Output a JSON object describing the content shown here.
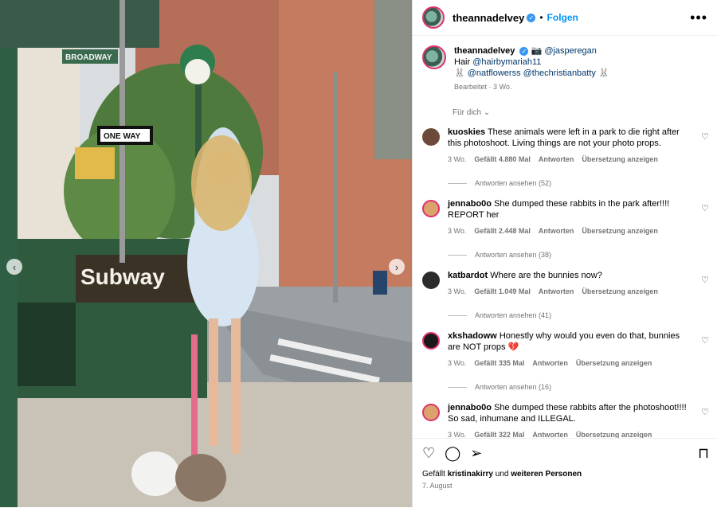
{
  "post": {
    "username": "theannadelvey",
    "follow_label": "Folgen",
    "more_label": "•••",
    "caption": {
      "line1_handle": "@jasperegan",
      "line2_prefix": "Hair ",
      "line2_handle": "@hairbymariah11",
      "line3_handle1": "@natflowerss",
      "line3_handle2": "@thechristianbatty",
      "meta": "Bearbeitet · 3 Wo."
    },
    "sort_label": "Für dich",
    "likes_prefix": "Gefällt ",
    "likes_user": "kristinakirry",
    "likes_mid": " und ",
    "likes_others": "weiteren Personen",
    "date": "7. August"
  },
  "street_signs": {
    "broadway": "BROADWAY",
    "one_way": "ONE WAY",
    "subway": "Subway"
  },
  "comments": [
    {
      "user": "kuoskies",
      "text": "These animals were left in a park to die right after this photoshoot. Living things are not your photo props.",
      "age": "3 Wo.",
      "likes": "Gefällt 4.880 Mal",
      "reply": "Antworten",
      "translate": "Übersetzung anzeigen",
      "view_replies": "Antworten ansehen (52)"
    },
    {
      "user": "jennabo0o",
      "text": "She dumped these rabbits in the park after!!!! REPORT her",
      "age": "3 Wo.",
      "likes": "Gefällt 2.448 Mal",
      "reply": "Antworten",
      "translate": "Übersetzung anzeigen",
      "view_replies": "Antworten ansehen (38)"
    },
    {
      "user": "katbardot",
      "text": "Where are the bunnies now?",
      "age": "3 Wo.",
      "likes": "Gefällt 1.049 Mal",
      "reply": "Antworten",
      "translate": "Übersetzung anzeigen",
      "view_replies": "Antworten ansehen (41)"
    },
    {
      "user": "xkshadoww",
      "text": "Honestly why would you even do that, bunnies are NOT props 💔",
      "age": "3 Wo.",
      "likes": "Gefällt 335 Mal",
      "reply": "Antworten",
      "translate": "Übersetzung anzeigen",
      "view_replies": "Antworten ansehen (16)"
    },
    {
      "user": "jennabo0o",
      "text": "She dumped these rabbits after the photoshoot!!!! So sad, inhumane and ILLEGAL.",
      "age": "3 Wo.",
      "likes": "Gefällt 322 Mal",
      "reply": "Antworten",
      "translate": "Übersetzung anzeigen",
      "view_replies": ""
    }
  ],
  "icons": [
    "heart-icon",
    "comment-icon",
    "share-icon",
    "bookmark-icon",
    "verified-icon",
    "chevron-down-icon"
  ],
  "colors": {
    "link": "#00376b",
    "follow": "#0095f6",
    "muted": "#737373",
    "verified": "#3897f0"
  }
}
